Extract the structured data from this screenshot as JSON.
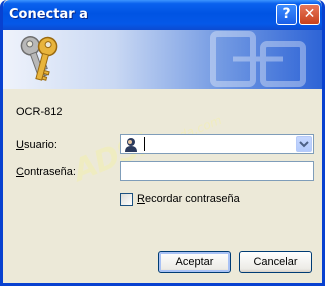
{
  "window": {
    "title": "Conectar a",
    "help_glyph": "?",
    "close_glyph": "✕",
    "frame_color": "#0841D0",
    "titlebar_color": "#0054E3"
  },
  "banner": {
    "icon": "keys-icon",
    "key_color": "#E8B43C"
  },
  "form": {
    "server_name": "OCR-812",
    "user_label_accel": "U",
    "user_label_rest": "suario:",
    "user_value": "",
    "user_icon": "user-icon",
    "password_label_accel": "C",
    "password_label_rest": "ontraseña:",
    "password_value": "",
    "remember_label_accel": "R",
    "remember_label_rest": "ecordar contraseña",
    "remember_checked": false
  },
  "buttons": {
    "ok_label": "Aceptar",
    "cancel_label": "Cancelar"
  },
  "watermark": {
    "main": "ADSL",
    "sub": "Ayuda.com"
  }
}
